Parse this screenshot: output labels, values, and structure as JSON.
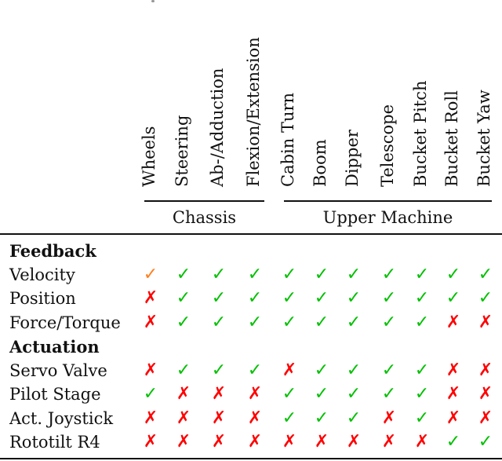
{
  "table": {
    "columns": [
      {
        "label": "Wheels",
        "group": "Chassis"
      },
      {
        "label": "Steering",
        "group": "Chassis"
      },
      {
        "label": "Ab-/Adduction",
        "group": "Chassis"
      },
      {
        "label": "Flexion/Extension",
        "group": "Chassis"
      },
      {
        "label": "Cabin Turn",
        "group": "Upper Machine"
      },
      {
        "label": "Boom",
        "group": "Upper Machine"
      },
      {
        "label": "Dipper",
        "group": "Upper Machine"
      },
      {
        "label": "Telescope",
        "group": "Upper Machine"
      },
      {
        "label": "Bucket Pitch",
        "group": "Upper Machine"
      },
      {
        "label": "Bucket Roll",
        "group": "Upper Machine"
      },
      {
        "label": "Bucket Yaw",
        "group": "Upper Machine"
      }
    ],
    "groups": [
      {
        "label": "Chassis"
      },
      {
        "label": "Upper Machine"
      }
    ],
    "sections": [
      {
        "title": "Feedback",
        "rows": [
          {
            "label": "Velocity",
            "values": [
              "partial",
              "yes",
              "yes",
              "yes",
              "yes",
              "yes",
              "yes",
              "yes",
              "yes",
              "yes",
              "yes"
            ]
          },
          {
            "label": "Position",
            "values": [
              "no",
              "yes",
              "yes",
              "yes",
              "yes",
              "yes",
              "yes",
              "yes",
              "yes",
              "yes",
              "yes"
            ]
          },
          {
            "label": "Force/Torque",
            "values": [
              "no",
              "yes",
              "yes",
              "yes",
              "yes",
              "yes",
              "yes",
              "yes",
              "yes",
              "no",
              "no"
            ]
          }
        ]
      },
      {
        "title": "Actuation",
        "rows": [
          {
            "label": "Servo Valve",
            "values": [
              "no",
              "yes",
              "yes",
              "yes",
              "no",
              "yes",
              "yes",
              "yes",
              "yes",
              "no",
              "no"
            ]
          },
          {
            "label": "Pilot Stage",
            "values": [
              "yes",
              "no",
              "no",
              "no",
              "yes",
              "yes",
              "yes",
              "yes",
              "yes",
              "no",
              "no"
            ]
          },
          {
            "label": "Act. Joystick",
            "values": [
              "no",
              "no",
              "no",
              "no",
              "yes",
              "yes",
              "yes",
              "no",
              "yes",
              "no",
              "no"
            ]
          },
          {
            "label": "Rototilt R4",
            "values": [
              "no",
              "no",
              "no",
              "no",
              "no",
              "no",
              "no",
              "no",
              "no",
              "yes",
              "yes"
            ]
          }
        ]
      }
    ]
  },
  "symbols": {
    "yes": {
      "glyph": "✓",
      "icon": "check-icon",
      "color": "#00c000"
    },
    "partial": {
      "glyph": "✓",
      "icon": "check-icon",
      "color": "#ff7f1f"
    },
    "no": {
      "glyph": "✗",
      "icon": "cross-icon",
      "color": "#ff0000"
    }
  }
}
